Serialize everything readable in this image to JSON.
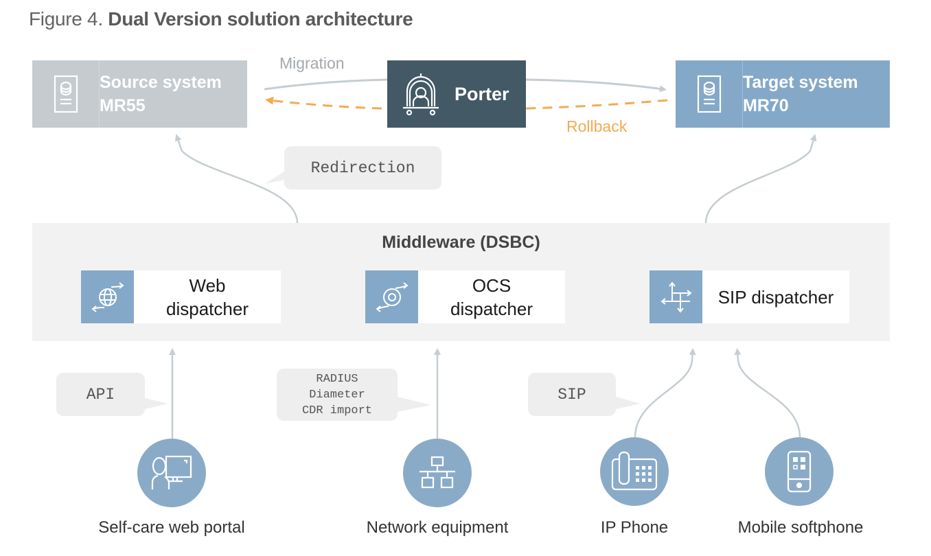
{
  "figure": {
    "prefix": "Figure 4.",
    "title": "Dual Version solution architecture"
  },
  "systems": {
    "source": {
      "line1": "Source system",
      "line2": "MR55",
      "icon": "server-database-icon"
    },
    "target": {
      "line1": "Target system",
      "line2": "MR70",
      "icon": "server-database-icon"
    },
    "porter": {
      "label": "Porter",
      "icon": "porter-bell-cart-icon"
    }
  },
  "flows": {
    "migration": "Migration",
    "rollback": "Rollback"
  },
  "bubbles": {
    "redirection": "Redirection",
    "api": "API",
    "radius_lines": [
      "RADIUS",
      "Diameter",
      "CDR import"
    ],
    "sip": "SIP"
  },
  "middleware": {
    "title": "Middleware (DSBC)",
    "dispatchers": [
      {
        "line1": "Web",
        "line2": "dispatcher",
        "icon": "globe-arrows-icon"
      },
      {
        "line1": "OCS",
        "line2": "dispatcher",
        "icon": "ring-arrows-icon"
      },
      {
        "line1": "SIP dispatcher",
        "line2": "",
        "icon": "four-way-arrows-icon"
      }
    ]
  },
  "endpoints": [
    {
      "label": "Self-care web portal",
      "icon": "user-computer-icon"
    },
    {
      "label": "Network equipment",
      "icon": "network-topology-icon"
    },
    {
      "label": "IP Phone",
      "icon": "desk-phone-icon"
    },
    {
      "label": "Mobile softphone",
      "icon": "mobile-phone-icon"
    }
  ],
  "colors": {
    "source_box": "#c5cbcf",
    "target_box": "#84a8c8",
    "porter_box": "#435966",
    "migration_arrow": "#c5cdd2",
    "rollback_arrow": "#f2ab52",
    "endpoint_circle": "#8aabc8",
    "middleware_bg": "#f2f2f2"
  }
}
